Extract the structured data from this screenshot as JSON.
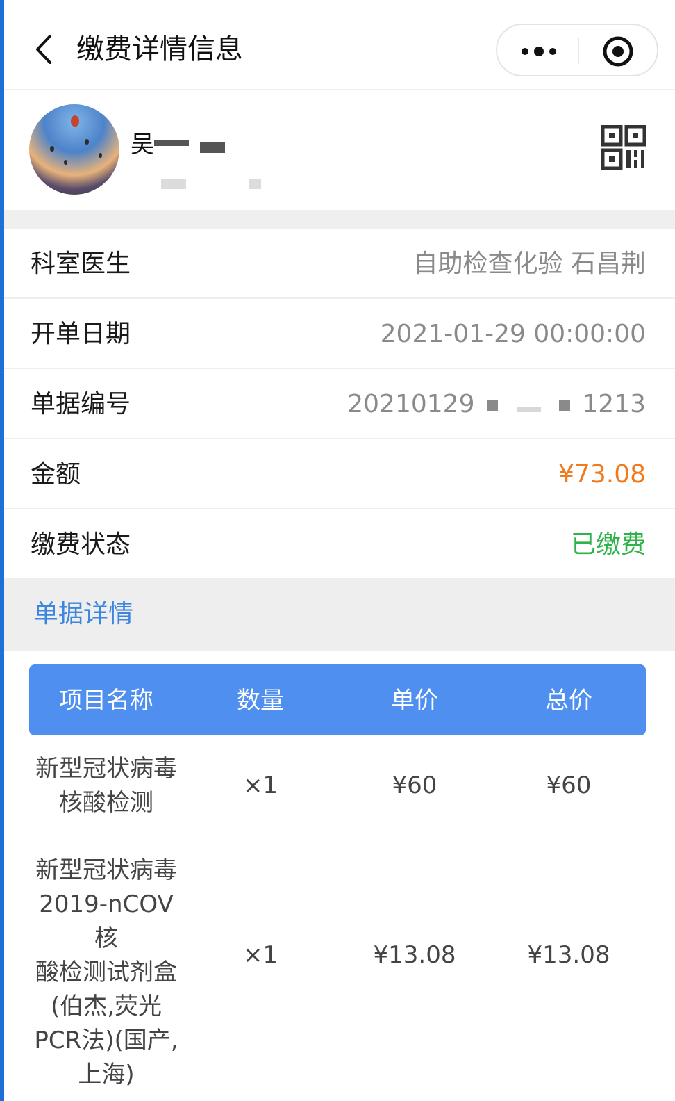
{
  "header": {
    "title": "缴费详情信息"
  },
  "profile": {
    "name": "吴"
  },
  "details": {
    "department_label": "科室医生",
    "department_value": "自助检查化验 石昌荆",
    "date_label": "开单日期",
    "date_value": "2021-01-29 00:00:00",
    "bill_no_label": "单据编号",
    "bill_no_prefix": "20210129",
    "bill_no_suffix": "1213",
    "amount_label": "金额",
    "amount_value": "¥73.08",
    "status_label": "缴费状态",
    "status_value": "已缴费"
  },
  "section": {
    "title": "单据详情"
  },
  "table": {
    "columns": [
      "项目名称",
      "数量",
      "单价",
      "总价"
    ],
    "rows": [
      {
        "name_lines": [
          "新型冠状病毒",
          "核酸检测"
        ],
        "qty": "×1",
        "unit_price": "¥60",
        "total": "¥60"
      },
      {
        "name_lines": [
          "新型冠状病毒",
          "2019-nCOV核",
          "酸检测试剂盒",
          "(伯杰,荧光",
          "PCR法)(国产,",
          "上海)"
        ],
        "qty": "×1",
        "unit_price": "¥13.08",
        "total": "¥13.08"
      }
    ]
  },
  "colors": {
    "accent_blue": "#4f8ff0",
    "amount_orange": "#f07b1e",
    "paid_green": "#2fb24a",
    "section_blue": "#3d86e0"
  }
}
